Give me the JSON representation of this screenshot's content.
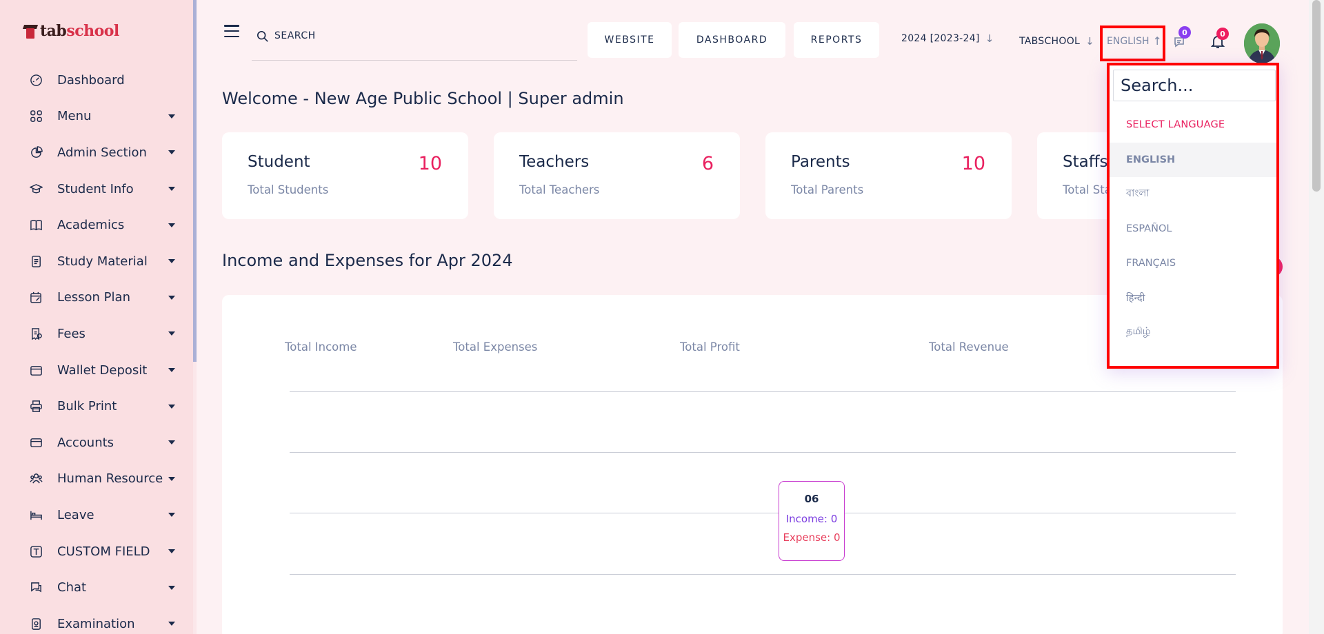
{
  "brand": {
    "part1": "tab",
    "part2": "school"
  },
  "sidebar": {
    "items": [
      {
        "label": "Dashboard",
        "icon": "dashboard-icon",
        "has_caret": false
      },
      {
        "label": "Menu",
        "icon": "grid-icon",
        "has_caret": true
      },
      {
        "label": "Admin Section",
        "icon": "pie-chart-icon",
        "has_caret": true
      },
      {
        "label": "Student Info",
        "icon": "graduation-cap-icon",
        "has_caret": true
      },
      {
        "label": "Academics",
        "icon": "book-icon",
        "has_caret": true
      },
      {
        "label": "Study Material",
        "icon": "document-icon",
        "has_caret": true
      },
      {
        "label": "Lesson Plan",
        "icon": "calendar-edit-icon",
        "has_caret": true
      },
      {
        "label": "Fees",
        "icon": "receipt-icon",
        "has_caret": true
      },
      {
        "label": "Wallet Deposit",
        "icon": "wallet-icon",
        "has_caret": true
      },
      {
        "label": "Bulk Print",
        "icon": "printer-icon",
        "has_caret": true
      },
      {
        "label": "Accounts",
        "icon": "card-icon",
        "has_caret": true
      },
      {
        "label": "Human Resource",
        "icon": "people-icon",
        "has_caret": true
      },
      {
        "label": "Leave",
        "icon": "bed-icon",
        "has_caret": true
      },
      {
        "label": "CUSTOM FIELD",
        "icon": "text-field-icon",
        "has_caret": true
      },
      {
        "label": "Chat",
        "icon": "chat-icon",
        "has_caret": true
      },
      {
        "label": "Examination",
        "icon": "exam-icon",
        "has_caret": true
      }
    ]
  },
  "header": {
    "search_placeholder": "SEARCH",
    "buttons": [
      "WEBSITE",
      "DASHBOARD",
      "REPORTS"
    ],
    "session": "2024 [2023-24]",
    "school": "TABSCHOOL",
    "language": "ENGLISH",
    "message_count": "0",
    "notification_count": "0"
  },
  "main": {
    "welcome": "Welcome - New Age Public School | Super admin",
    "cards": [
      {
        "title": "Student",
        "sub": "Total Students",
        "count": "10"
      },
      {
        "title": "Teachers",
        "sub": "Total Teachers",
        "count": "6"
      },
      {
        "title": "Parents",
        "sub": "Total Parents",
        "count": "10"
      },
      {
        "title": "Staffs",
        "sub": "Total Staffs",
        "count": ""
      }
    ],
    "income_title": "Income and Expenses for Apr 2024",
    "chart_headers": [
      "Total Income",
      "Total Expenses",
      "Total Profit",
      "Total Revenue"
    ],
    "tooltip": {
      "date": "06",
      "income": "Income: 0",
      "expense": "Expense: 0"
    }
  },
  "language_menu": {
    "search_placeholder": "Search...",
    "heading": "SELECT LANGUAGE",
    "options": [
      "ENGLISH",
      "বাংলা",
      "ESPAÑOL",
      "FRANÇAIS",
      "हिन्दी",
      "தமிழ்"
    ],
    "selected": "ENGLISH"
  },
  "colors": {
    "accent": "#e9205f",
    "highlight": "#ff0000",
    "sidebar": "#fadfe2",
    "text": "#1b2a4a"
  }
}
